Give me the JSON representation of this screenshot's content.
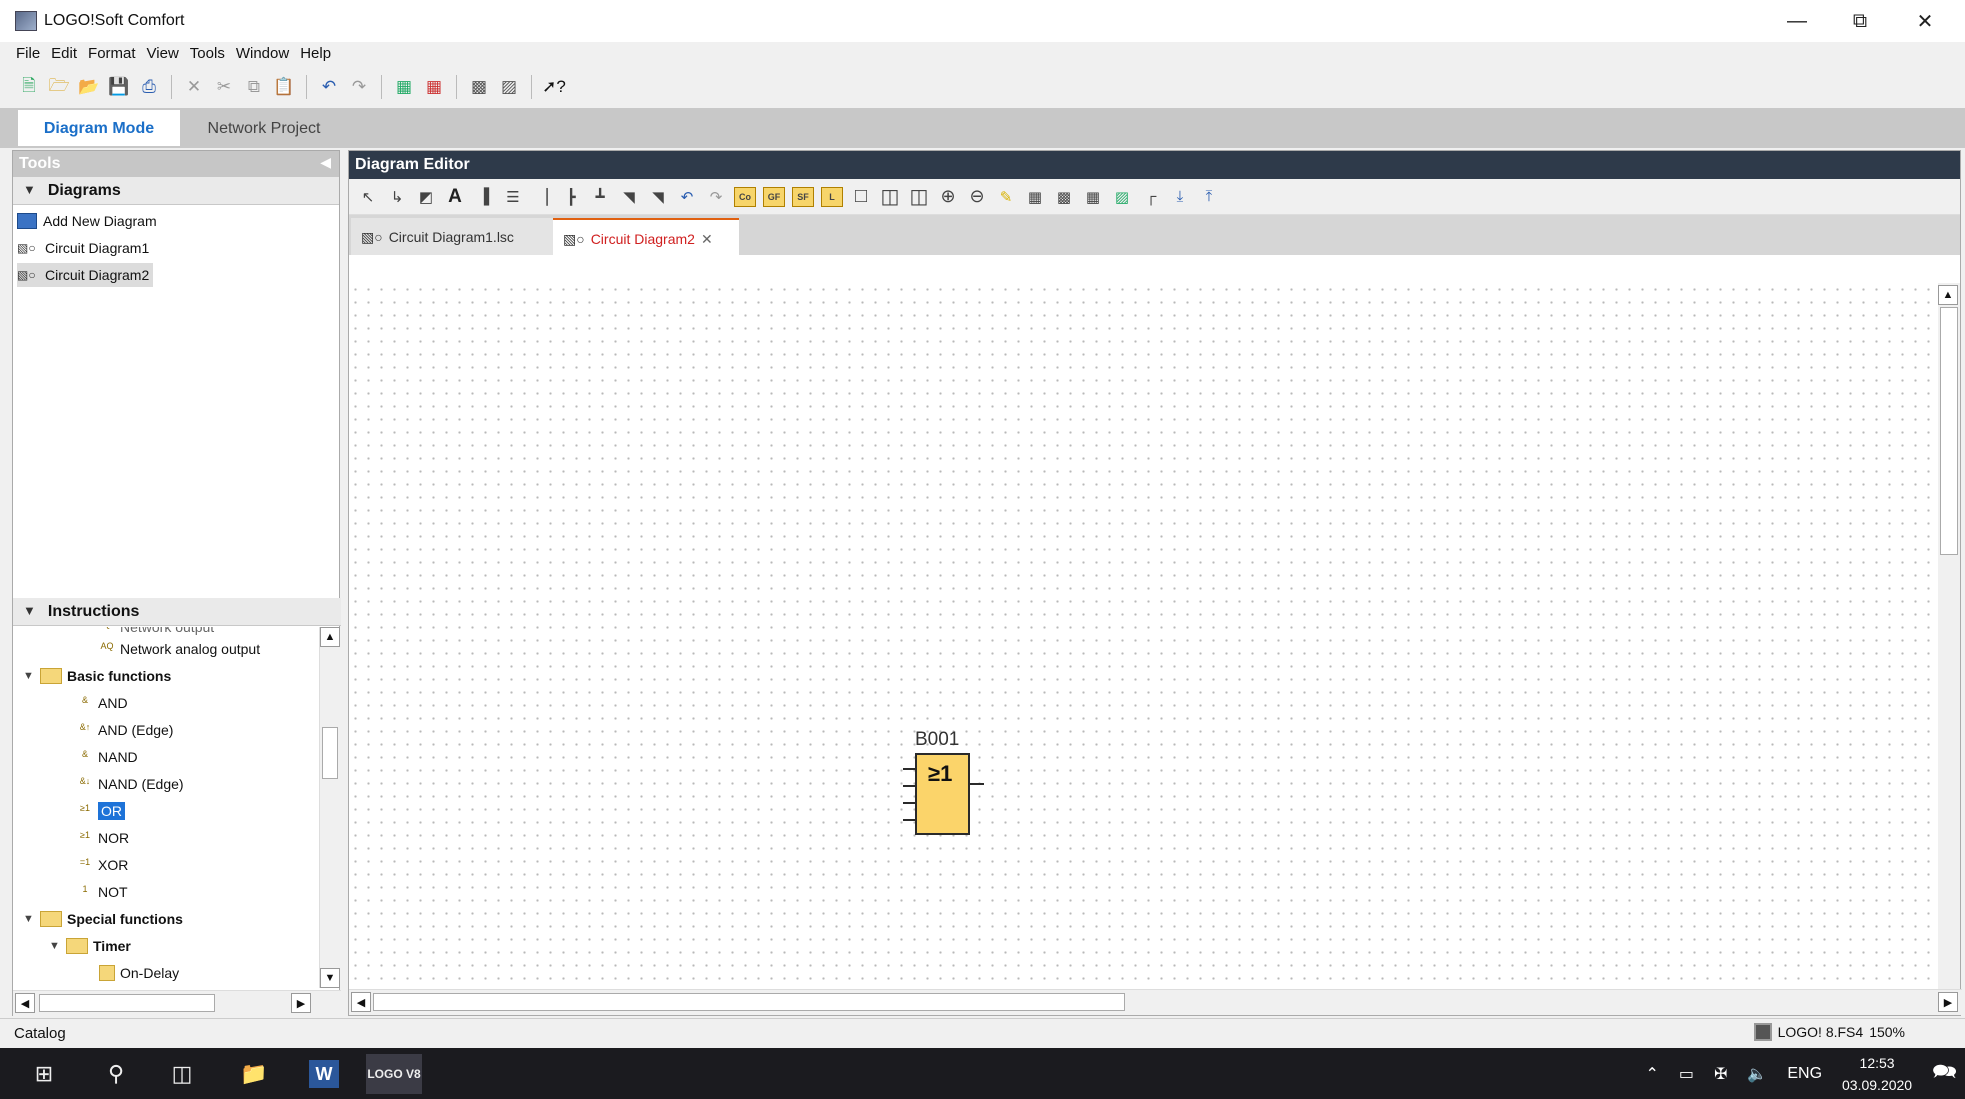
{
  "window": {
    "title": "LOGO!Soft Comfort"
  },
  "menu": [
    "File",
    "Edit",
    "Format",
    "View",
    "Tools",
    "Window",
    "Help"
  ],
  "mode_tabs": {
    "diagram_mode": "Diagram Mode",
    "network_project": "Network Project"
  },
  "tools_panel": {
    "title": "Tools",
    "diagrams_header": "Diagrams",
    "diagrams": [
      "Add New Diagram",
      "Circuit Diagram1",
      "Circuit Diagram2"
    ],
    "instructions_header": "Instructions",
    "tree": {
      "partial_item": "Network output",
      "network_analog_output": "Network analog output",
      "basic_functions": "Basic functions",
      "basic_items": [
        "AND",
        "AND (Edge)",
        "NAND",
        "NAND (Edge)",
        "OR",
        "NOR",
        "XOR",
        "NOT"
      ],
      "special_functions": "Special functions",
      "timer": "Timer",
      "on_delay": "On-Delay"
    }
  },
  "editor": {
    "title": "Diagram Editor",
    "tabs": [
      "Circuit Diagram1.lsc",
      "Circuit Diagram2"
    ],
    "active_tab_index": 1,
    "block": {
      "id": "B001",
      "symbol": "≥1"
    }
  },
  "status_bar": {
    "left": "Catalog",
    "device": "LOGO! 8.FS4",
    "zoom": "150%"
  },
  "taskbar": {
    "logo_app": "LOGO V8",
    "language": "ENG",
    "time": "12:53",
    "date": "03.09.2020"
  }
}
